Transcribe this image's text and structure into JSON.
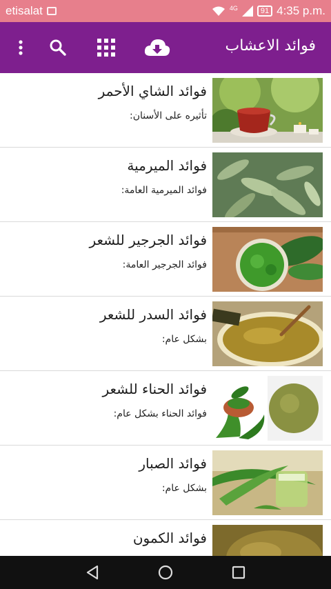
{
  "status_bar": {
    "carrier": "etisalat",
    "network": "4G",
    "battery": "91",
    "time": "4:35 p.m."
  },
  "app_bar": {
    "title": "فوائد الاعشاب",
    "background": "#7e1f8e"
  },
  "items": [
    {
      "title": "فوائد الشاي الأحمر",
      "subtitle": "تأثيره على الأسنان:",
      "image": "red-tea"
    },
    {
      "title": "فوائد الميرمية",
      "subtitle": "فوائد الميرمية العامة:",
      "image": "sage-leaves"
    },
    {
      "title": "فوائد الجرجير للشعر",
      "subtitle": "فوائد الجرجير العامة:",
      "image": "arugula-paste"
    },
    {
      "title": "فوائد السدر للشعر",
      "subtitle": "بشكل عام:",
      "image": "sidr-powder"
    },
    {
      "title": "فوائد الحناء للشعر",
      "subtitle": "فوائد الحناء بشكل عام:",
      "image": "henna-powder"
    },
    {
      "title": "فوائد الصبار",
      "subtitle": "بشكل عام:",
      "image": "aloe-vera"
    },
    {
      "title": "فوائد الكمون",
      "subtitle": "",
      "image": "cumin-seeds"
    }
  ]
}
